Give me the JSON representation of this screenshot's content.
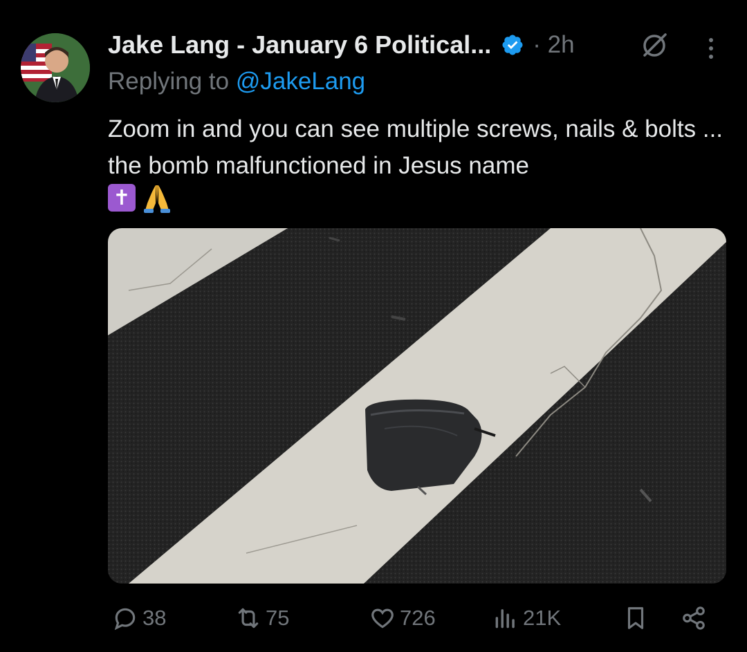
{
  "tweet": {
    "author_name": "Jake Lang - January 6 Political...",
    "time": "· 2h",
    "replying_prefix": "Replying to ",
    "replying_handle": "@JakeLang",
    "text": "Zoom in and you can see multiple screws, nails & bolts ... the bomb malfunctioned in Jesus name",
    "emoji_cross": "✝",
    "emoji_pray": "🙏"
  },
  "icons": {
    "verified": "verified-badge-icon",
    "grok": "grok-icon",
    "more": "more-options-icon",
    "reply": "reply-icon",
    "retweet": "retweet-icon",
    "like": "like-icon",
    "views": "views-icon",
    "bookmark": "bookmark-icon",
    "share": "share-icon"
  },
  "stats": {
    "replies": "38",
    "retweets": "75",
    "likes": "726",
    "views": "21K"
  },
  "colors": {
    "background": "#000000",
    "primary_text": "#e7e9ea",
    "secondary_text": "#71767b",
    "accent": "#1d9bf0"
  }
}
